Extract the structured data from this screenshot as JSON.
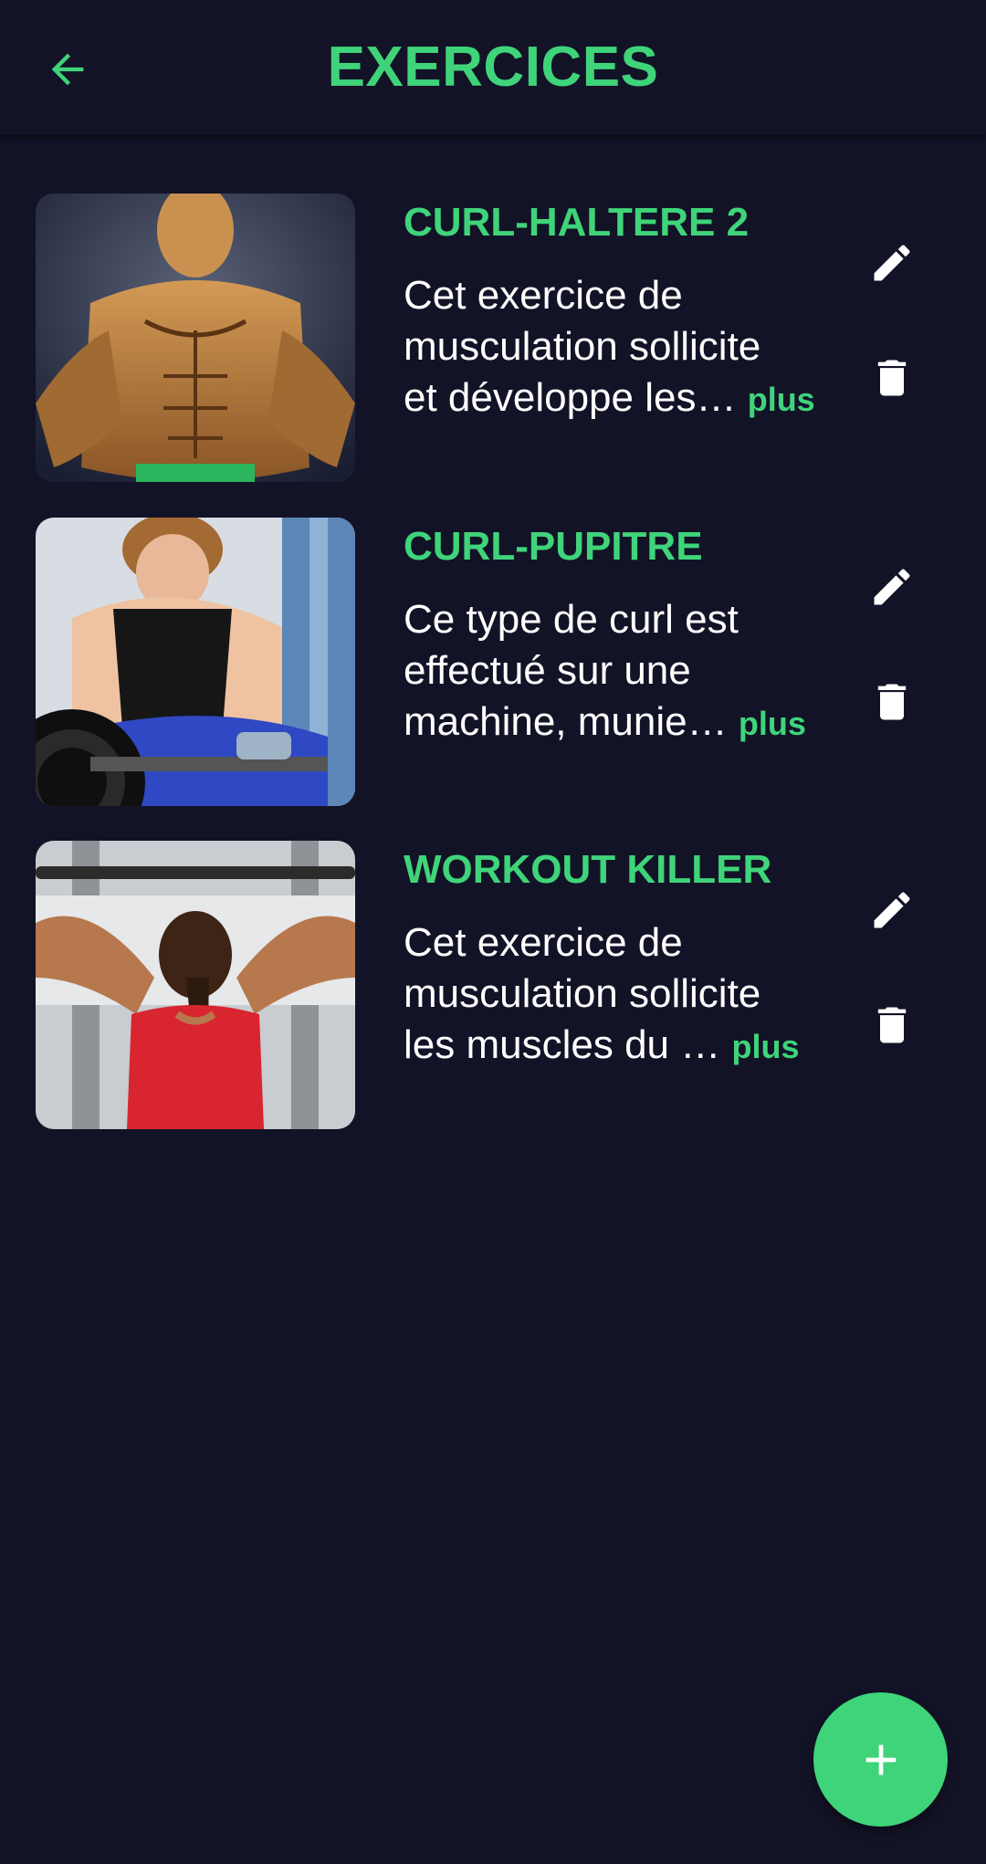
{
  "header": {
    "title": "EXERCICES",
    "back_icon": "arrow-back-icon"
  },
  "colors": {
    "background": "#131327",
    "accent": "#3fd47a",
    "text": "#ffffff"
  },
  "exercises": [
    {
      "name": "CURL-HALTERE 2",
      "description_lines": [
        "Cet exercice de",
        "musculation sollicite",
        "et développe les…"
      ],
      "more_label": "plus",
      "image": "muscular-man-flexing-photo"
    },
    {
      "name": "CURL-PUPITRE",
      "description_lines": [
        "Ce type de curl est",
        "effectué sur une",
        "machine, munie…"
      ],
      "more_label": "plus",
      "image": "man-preacher-curl-photo"
    },
    {
      "name": "WORKOUT KILLER",
      "description_lines": [
        "Cet exercice de",
        "musculation sollicite",
        "les muscles du …"
      ],
      "more_label": "plus",
      "image": "woman-lat-pulldown-photo"
    }
  ],
  "actions": {
    "edit_icon": "pencil-icon",
    "delete_icon": "trash-icon",
    "add_icon": "plus-icon"
  }
}
